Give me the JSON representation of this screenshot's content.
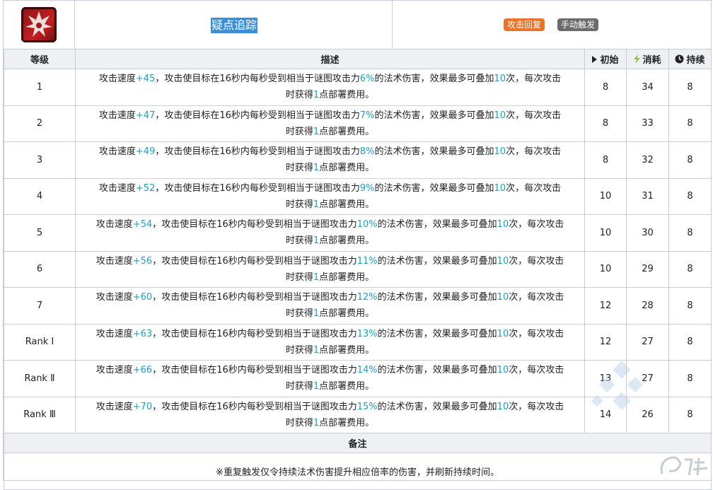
{
  "skill": {
    "name": "疑点追踪",
    "tags": {
      "recovery": "攻击回复",
      "trigger": "手动触发"
    },
    "icon": "skill-emblem-icon"
  },
  "table": {
    "headers": {
      "level": "等级",
      "description": "描述",
      "initial": "初始",
      "cost": "消耗",
      "duration": "持续"
    },
    "rows": [
      {
        "level": "1",
        "d1": "攻击速度",
        "v1": "+45",
        "d2": "，攻击使目标在16秒内每秒受到相当于谜图攻击力",
        "v2": "6%",
        "d3": "的法术伤害，效果最多可叠加",
        "v3": "10",
        "d4": "次，每次攻击",
        "d5": "时获得",
        "v4": "1",
        "d6": "点部署费用。",
        "initial": "8",
        "cost": "34",
        "duration": "8"
      },
      {
        "level": "2",
        "d1": "攻击速度",
        "v1": "+47",
        "d2": "，攻击使目标在16秒内每秒受到相当于谜图攻击力",
        "v2": "7%",
        "d3": "的法术伤害，效果最多可叠加",
        "v3": "10",
        "d4": "次，每次攻击",
        "d5": "时获得",
        "v4": "1",
        "d6": "点部署费用。",
        "initial": "8",
        "cost": "33",
        "duration": "8"
      },
      {
        "level": "3",
        "d1": "攻击速度",
        "v1": "+49",
        "d2": "，攻击使目标在16秒内每秒受到相当于谜图攻击力",
        "v2": "8%",
        "d3": "的法术伤害，效果最多可叠加",
        "v3": "10",
        "d4": "次，每次攻击",
        "d5": "时获得",
        "v4": "1",
        "d6": "点部署费用。",
        "initial": "8",
        "cost": "32",
        "duration": "8"
      },
      {
        "level": "4",
        "d1": "攻击速度",
        "v1": "+52",
        "d2": "，攻击使目标在16秒内每秒受到相当于谜图攻击力",
        "v2": "9%",
        "d3": "的法术伤害，效果最多可叠加",
        "v3": "10",
        "d4": "次，每次攻击",
        "d5": "时获得",
        "v4": "1",
        "d6": "点部署费用。",
        "initial": "10",
        "cost": "31",
        "duration": "8"
      },
      {
        "level": "5",
        "d1": "攻击速度",
        "v1": "+54",
        "d2": "，攻击使目标在16秒内每秒受到相当于谜图攻击力",
        "v2": "10%",
        "d3": "的法术伤害，效果最多可叠加",
        "v3": "10",
        "d4": "次，每次攻击",
        "d5": "时获得",
        "v4": "1",
        "d6": "点部署费用。",
        "initial": "10",
        "cost": "30",
        "duration": "8"
      },
      {
        "level": "6",
        "d1": "攻击速度",
        "v1": "+56",
        "d2": "，攻击使目标在16秒内每秒受到相当于谜图攻击力",
        "v2": "11%",
        "d3": "的法术伤害，效果最多可叠加",
        "v3": "10",
        "d4": "次，每次攻击",
        "d5": "时获得",
        "v4": "1",
        "d6": "点部署费用。",
        "initial": "10",
        "cost": "29",
        "duration": "8"
      },
      {
        "level": "7",
        "d1": "攻击速度",
        "v1": "+60",
        "d2": "，攻击使目标在16秒内每秒受到相当于谜图攻击力",
        "v2": "12%",
        "d3": "的法术伤害，效果最多可叠加",
        "v3": "10",
        "d4": "次，每次攻击",
        "d5": "时获得",
        "v4": "1",
        "d6": "点部署费用。",
        "initial": "12",
        "cost": "28",
        "duration": "8"
      },
      {
        "level": "Rank Ⅰ",
        "d1": "攻击速度",
        "v1": "+63",
        "d2": "，攻击使目标在16秒内每秒受到相当于谜图攻击力",
        "v2": "13%",
        "d3": "的法术伤害，效果最多可叠加",
        "v3": "10",
        "d4": "次，每次攻击",
        "d5": "时获得",
        "v4": "1",
        "d6": "点部署费用。",
        "initial": "12",
        "cost": "27",
        "duration": "8"
      },
      {
        "level": "Rank Ⅱ",
        "d1": "攻击速度",
        "v1": "+66",
        "d2": "，攻击使目标在16秒内每秒受到相当于谜图攻击力",
        "v2": "14%",
        "d3": "的法术伤害，效果最多可叠加",
        "v3": "10",
        "d4": "次，每次攻击",
        "d5": "时获得",
        "v4": "1",
        "d6": "点部署费用。",
        "initial": "13",
        "cost": "27",
        "duration": "8"
      },
      {
        "level": "Rank Ⅲ",
        "d1": "攻击速度",
        "v1": "+70",
        "d2": "，攻击使目标在16秒内每秒受到相当于谜图攻击力",
        "v2": "15%",
        "d3": "的法术伤害，效果最多可叠加",
        "v3": "10",
        "d4": "次，每次攻击",
        "d5": "时获得",
        "v4": "1",
        "d6": "点部署费用。",
        "initial": "14",
        "cost": "26",
        "duration": "8"
      }
    ]
  },
  "notes": {
    "header": "备注",
    "text": "※重复触发仅令持续法术伤害提升相应倍率的伤害，并刷新持续时间。"
  },
  "colors": {
    "highlight": "#1aa1c9",
    "tag_recovery": "#e8742b",
    "tag_trigger": "#6b6b6b",
    "selection": "#3b8fd9",
    "cost_icon": "#8cc63f"
  }
}
